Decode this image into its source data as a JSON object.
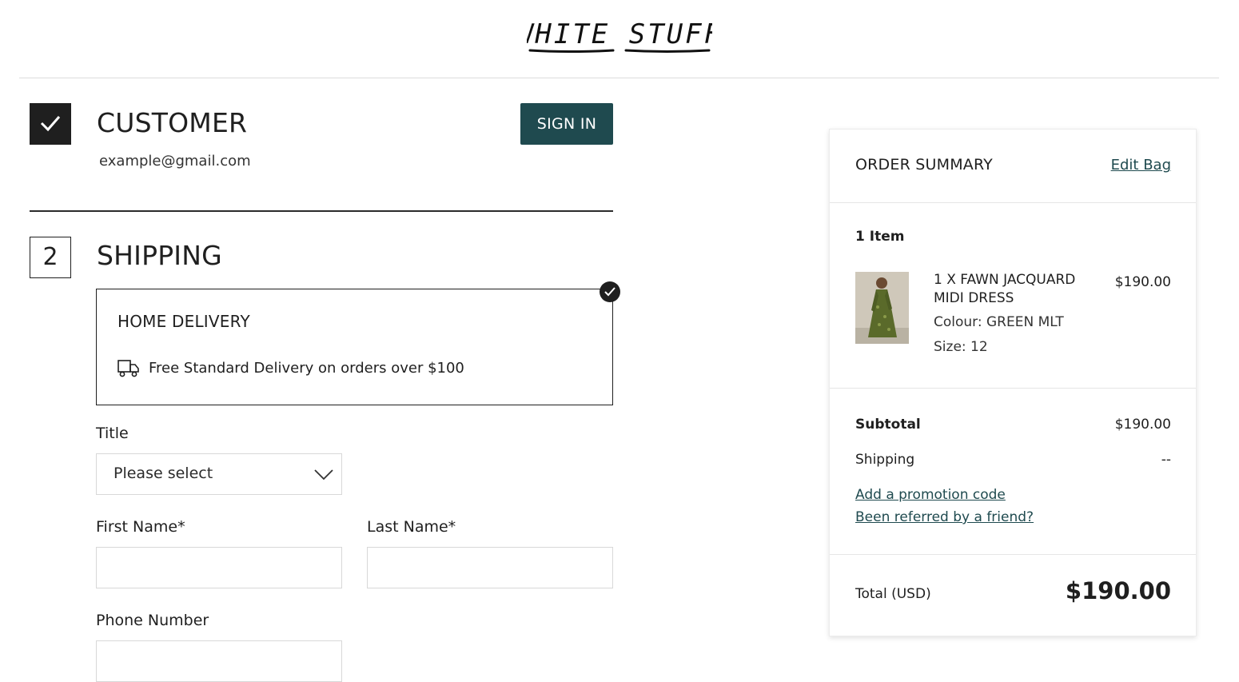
{
  "header": {
    "brand": "WHITE STUFF"
  },
  "customer": {
    "title": "CUSTOMER",
    "email": "example@gmail.com",
    "sign_in_label": "SIGN IN"
  },
  "shipping": {
    "step_number": "2",
    "title": "SHIPPING",
    "delivery_option": {
      "title": "HOME DELIVERY",
      "description": "Free Standard Delivery on orders over $100",
      "selected": true
    },
    "form": {
      "title_label": "Title",
      "title_value": "Please select",
      "first_name_label": "First Name*",
      "first_name_value": "",
      "last_name_label": "Last Name*",
      "last_name_value": "",
      "phone_label": "Phone Number",
      "phone_value": ""
    }
  },
  "order_summary": {
    "title": "ORDER SUMMARY",
    "edit_bag_label": "Edit Bag",
    "item_count": "1 Item",
    "items": [
      {
        "name": "1 X FAWN JACQUARD MIDI DRESS",
        "price": "$190.00",
        "colour": "Colour: GREEN MLT",
        "size": "Size: 12"
      }
    ],
    "subtotal_label": "Subtotal",
    "subtotal_value": "$190.00",
    "shipping_label": "Shipping",
    "shipping_value": "--",
    "promo_link": "Add a promotion code",
    "referral_link": "Been referred by a friend?",
    "total_label": "Total (USD)",
    "total_value": "$190.00"
  },
  "colors": {
    "accent": "#1f4a4f",
    "text": "#1f1f1f",
    "border": "#d8d8d8"
  },
  "icons": [
    "check-icon",
    "truck-icon",
    "chevron-down-icon",
    "selected-check-icon"
  ]
}
